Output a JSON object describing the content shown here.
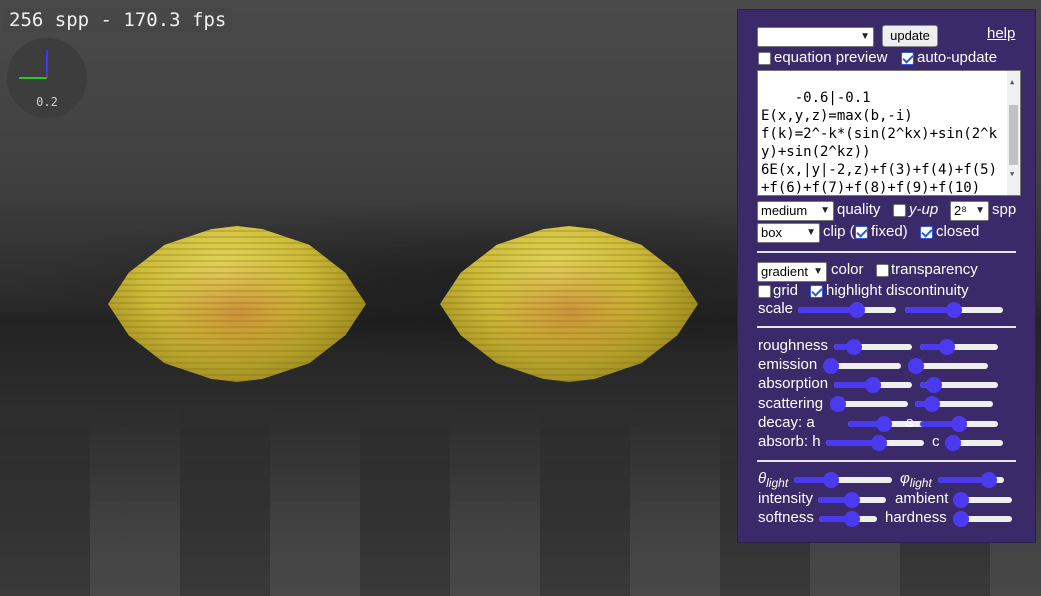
{
  "overlay": {
    "fps_text": "256 spp - 170.3 fps",
    "axis_scale": "0.2"
  },
  "panel": {
    "preset_select": "",
    "update_label": "update",
    "help_label": "help",
    "equation_preview_label": "equation preview",
    "equation_preview_checked": false,
    "auto_update_label": "auto-update",
    "auto_update_checked": true,
    "equation_text": "-0.6|-0.1\nE(x,y,z)=max(b,-i)\nf(k)=2^-k*(sin(2^kx)+sin(2^ky)+sin(2^kz))\n6E(x,|y|-2,z)+f(3)+f(4)+f(5)+f(6)+f(7)+f(8)+f(9)+f(10)",
    "quality_select": "medium",
    "quality_label": "quality",
    "yup_label": "y-up",
    "yup_checked": false,
    "spp_select": "2⁸",
    "spp_label": "spp",
    "clip_select": "box",
    "clip_label": "clip (",
    "fixed_label": "fixed)",
    "fixed_checked": true,
    "closed_label": "closed",
    "closed_checked": true,
    "color_select": "gradient",
    "color_label": "color",
    "transparency_label": "transparency",
    "transparency_checked": false,
    "grid_label": "grid",
    "grid_checked": false,
    "highlight_label": "highlight discontinuity",
    "highlight_checked": true,
    "scale_label": "scale",
    "roughness_label": "roughness",
    "emission_label": "emission",
    "absorption_label": "absorption",
    "scattering_label": "scattering",
    "decay_label": "decay: a",
    "decay_s_label": "s",
    "absorb_label": "absorb: h",
    "absorb_c_label": "c",
    "theta_symbol": "θ",
    "phi_symbol": "φ",
    "light_sub": "light",
    "intensity_label": "intensity",
    "ambient_label": "ambient",
    "softness_label": "softness",
    "hardness_label": "hardness",
    "sliders": {
      "scale_1": 0.62,
      "scale_2": 0.5,
      "roughness_1": 0.2,
      "roughness_2": 0.3,
      "emission_1": 0.0,
      "emission_2": 0.0,
      "absorption_1": 0.5,
      "absorption_2": 0.1,
      "scattering_1": 0.0,
      "scattering_2": 0.15,
      "decay_a": 0.45,
      "decay_s": 0.5,
      "absorb_h": 0.55,
      "absorb_c": 0.0,
      "theta_light": 0.35,
      "phi_light": 0.85,
      "intensity": 0.5,
      "ambient": 0.0,
      "softness": 0.6,
      "hardness": 0.0
    },
    "accent_color": "#4b3af0",
    "panel_color": "#3b2a6a"
  }
}
